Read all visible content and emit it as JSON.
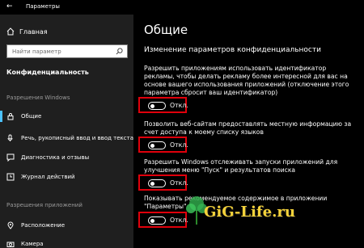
{
  "titlebar": {
    "back_glyph": "←",
    "title": "Параметры"
  },
  "sidebar": {
    "home_label": "Главная",
    "search_placeholder": "Найти параметр",
    "category": "Конфиденциальность",
    "sections": [
      {
        "label": "Разрешения Windows"
      },
      {
        "label": "Разрешения приложений"
      }
    ],
    "items": [
      {
        "label": "Общие",
        "icon": "lock-icon",
        "active": true
      },
      {
        "label": "Речь, рукописный ввод и ввод текста",
        "icon": "mic-pen-icon"
      },
      {
        "label": "Диагностика и отзывы",
        "icon": "feedback-icon"
      },
      {
        "label": "Журнал действий",
        "icon": "history-icon"
      },
      {
        "label": "Расположение",
        "icon": "location-icon"
      },
      {
        "label": "Камера",
        "icon": "camera-icon"
      }
    ]
  },
  "main": {
    "title": "Общие",
    "subtitle": "Изменение параметров конфиденциальности",
    "settings": [
      {
        "text": "Разрешить приложениям использовать идентификатор рекламы, чтобы делать рекламу более интересной для вас на основе вашего использования приложений (отключение этого параметра сбросит ваш идентификатор)",
        "state": "Откл."
      },
      {
        "text": "Позволить веб-сайтам предоставлять местную информацию за счет доступа к моему списку языков",
        "state": "Откл."
      },
      {
        "text": "Разрешить Windows отслеживать запуски приложений для улучшения меню \"Пуск\" и результатов поиска",
        "state": "Откл."
      },
      {
        "text": "Показывать рекомендуемое содержимое в приложении \"Параметры\"",
        "state": "Откл."
      }
    ]
  },
  "watermark": "GiG-Life.ru",
  "colors": {
    "accent": "#4cc2ff",
    "highlight": "#e0000b",
    "watermark": "#f4d23a"
  }
}
